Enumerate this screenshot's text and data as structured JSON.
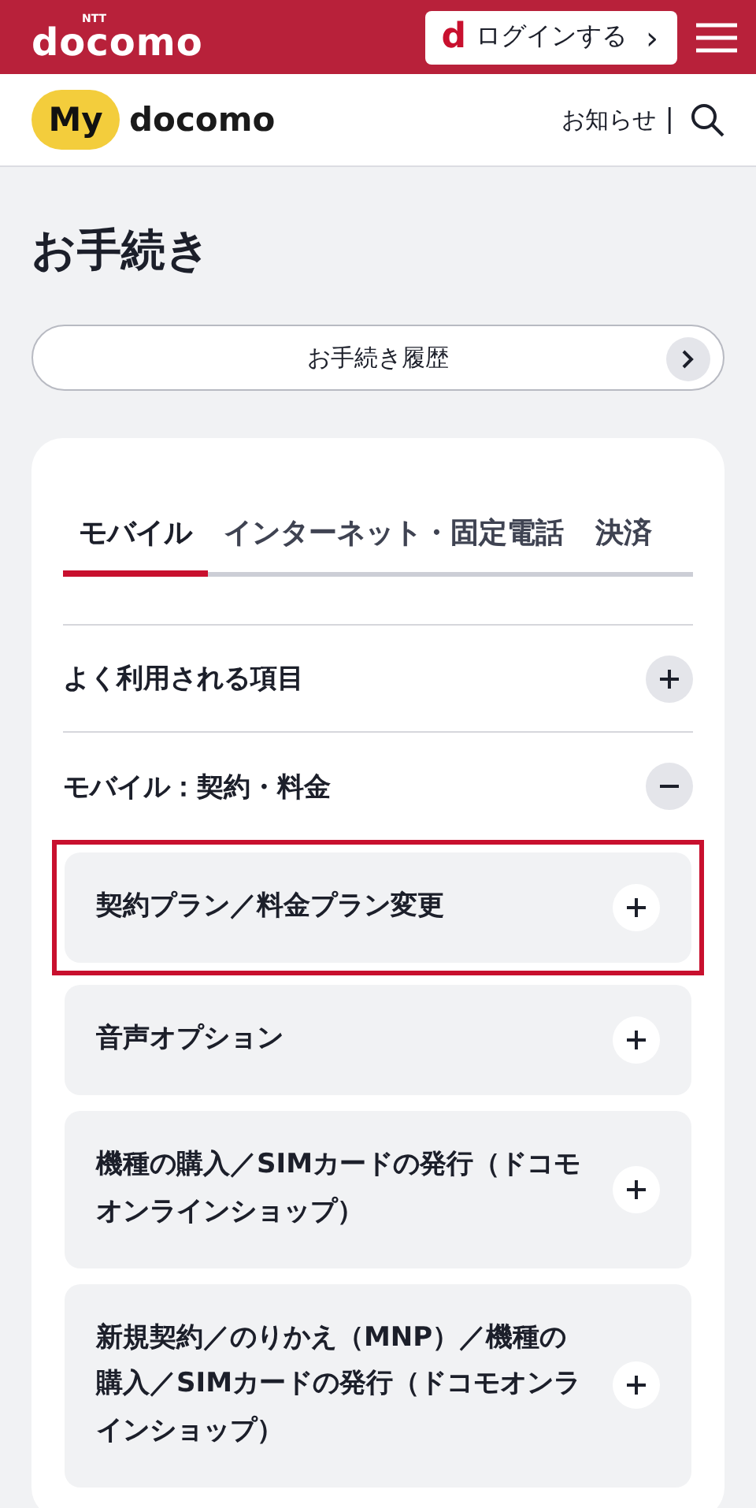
{
  "header": {
    "brand": {
      "small": "NTT",
      "name": "docomo"
    },
    "login_button": {
      "icon_letter": "d",
      "label": "ログインする",
      "chevron": "›"
    }
  },
  "subheader": {
    "logo": {
      "badge": "My",
      "name": "docomo"
    },
    "notice_link": "お知らせ",
    "separator": "|"
  },
  "page_title": "お手続き",
  "history_button": {
    "label": "お手続き履歴"
  },
  "tabs": [
    {
      "label": "モバイル",
      "selected": true
    },
    {
      "label": "インターネット・固定電話",
      "selected": false
    },
    {
      "label": "決済",
      "selected": false
    }
  ],
  "sections": [
    {
      "title": "よく利用される項目",
      "expanded": false
    },
    {
      "title": "モバイル：契約・料金",
      "expanded": true,
      "items": [
        {
          "label": "契約プラン／料金プラン変更",
          "expanded": false,
          "highlighted": true
        },
        {
          "label": "音声オプション",
          "expanded": false,
          "highlighted": false
        },
        {
          "label": "機種の購入／SIMカードの発行（ドコモオンラインショップ）",
          "expanded": false,
          "highlighted": false
        },
        {
          "label": "新規契約／のりかえ（MNP）／機種の購入／SIMカードの発行（ドコモオンラインショップ）",
          "expanded": false,
          "highlighted": false
        }
      ]
    }
  ]
}
